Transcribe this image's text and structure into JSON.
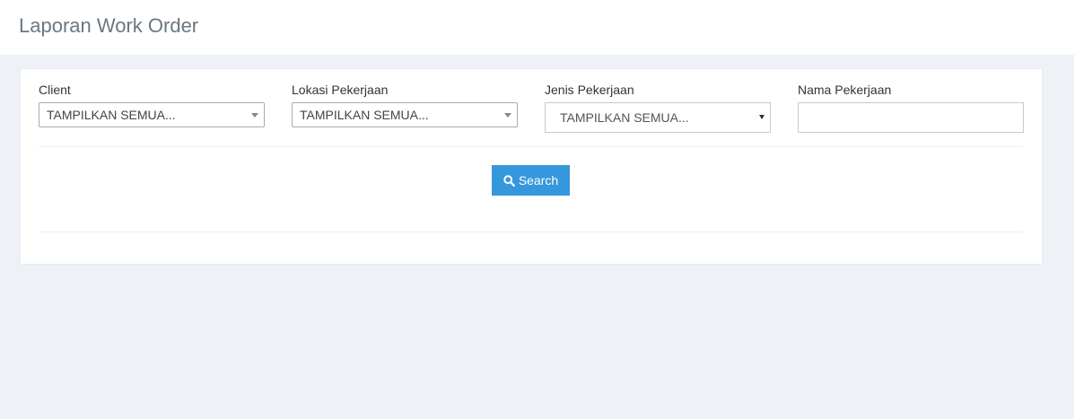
{
  "page": {
    "title": "Laporan Work Order"
  },
  "filters": {
    "client": {
      "label": "Client",
      "value": "TAMPILKAN SEMUA..."
    },
    "lokasi": {
      "label": "Lokasi Pekerjaan",
      "value": "TAMPILKAN SEMUA..."
    },
    "jenis": {
      "label": "Jenis Pekerjaan",
      "value": "TAMPILKAN SEMUA..."
    },
    "nama": {
      "label": "Nama Pekerjaan",
      "value": ""
    }
  },
  "actions": {
    "search_label": "Search",
    "search_icon": "search-icon"
  },
  "colors": {
    "primary": "#3598dc",
    "background": "#eef1f5",
    "title": "#697882"
  }
}
